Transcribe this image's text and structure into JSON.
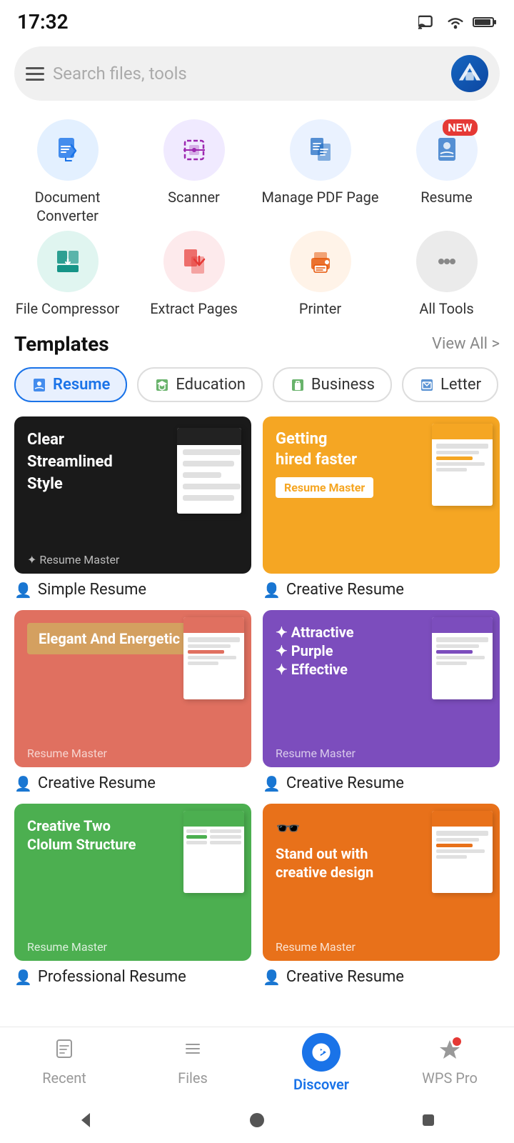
{
  "status": {
    "time": "17:32",
    "wifi": true,
    "battery": true
  },
  "search": {
    "placeholder": "Search files, tools"
  },
  "tools": [
    {
      "id": "document-converter",
      "label": "Document\nConverter",
      "colorClass": "blue-light",
      "icon": "converter"
    },
    {
      "id": "scanner",
      "label": "Scanner",
      "colorClass": "purple-light",
      "icon": "scanner"
    },
    {
      "id": "manage-pdf",
      "label": "Manage PDF\nPage",
      "colorClass": "blue2-light",
      "icon": "pdf"
    },
    {
      "id": "resume",
      "label": "Resume",
      "colorClass": "blue2-light",
      "icon": "resume",
      "badge": "NEW"
    },
    {
      "id": "file-compressor",
      "label": "File\nCompressor",
      "colorClass": "teal-light",
      "icon": "compress"
    },
    {
      "id": "extract-pages",
      "label": "Extract Pages",
      "colorClass": "red-light",
      "icon": "extract"
    },
    {
      "id": "printer",
      "label": "Printer",
      "colorClass": "orange-light",
      "icon": "printer"
    },
    {
      "id": "all-tools",
      "label": "All Tools",
      "colorClass": "gray-light",
      "icon": "more"
    }
  ],
  "templates": {
    "section_title": "Templates",
    "view_all_label": "View All >",
    "categories": [
      {
        "id": "resume",
        "label": "Resume",
        "active": true,
        "icon": "👤"
      },
      {
        "id": "education",
        "label": "Education",
        "active": false,
        "icon": "🎓"
      },
      {
        "id": "business",
        "label": "Business",
        "active": false,
        "icon": "💼"
      },
      {
        "id": "letter",
        "label": "Letter",
        "active": false,
        "icon": "📄"
      }
    ],
    "cards": [
      {
        "id": "simple-resume",
        "name": "Simple Resume",
        "thumb_text": "Clear\nStreamlined\nStyle",
        "bg_class": "dark",
        "tagline": "",
        "brand": "Resume Master"
      },
      {
        "id": "creative-resume-1",
        "name": "Creative Resume",
        "thumb_text": "Getting\nhired faster",
        "bg_class": "yellow",
        "tagline": "",
        "brand": "Resume Master"
      },
      {
        "id": "creative-resume-2",
        "name": "Creative Resume",
        "thumb_text": "Elegant And Energetic",
        "bg_class": "coral",
        "tagline": "",
        "brand": "Resume Master"
      },
      {
        "id": "creative-resume-3",
        "name": "Creative Resume",
        "thumb_text": "Attractive\nPurple\nEffective",
        "bg_class": "purple",
        "tagline": "",
        "brand": "Resume Master"
      },
      {
        "id": "professional-resume",
        "name": "Professional Resume",
        "thumb_text": "Creative Two\nClolum Structure",
        "bg_class": "green",
        "tagline": "",
        "brand": "Resume Master"
      },
      {
        "id": "creative-resume-4",
        "name": "Creative Resume",
        "thumb_text": "Stand out with\ncreative design",
        "bg_class": "orange",
        "tagline": "",
        "brand": "Resume Master"
      }
    ]
  },
  "bottom_nav": {
    "items": [
      {
        "id": "recent",
        "label": "Recent",
        "icon": "📋",
        "active": false
      },
      {
        "id": "files",
        "label": "Files",
        "icon": "☰",
        "active": false
      },
      {
        "id": "discover",
        "label": "Discover",
        "icon": "compass",
        "active": true
      },
      {
        "id": "wps-pro",
        "label": "WPS Pro",
        "icon": "⚡",
        "active": false,
        "dot": true
      }
    ]
  }
}
